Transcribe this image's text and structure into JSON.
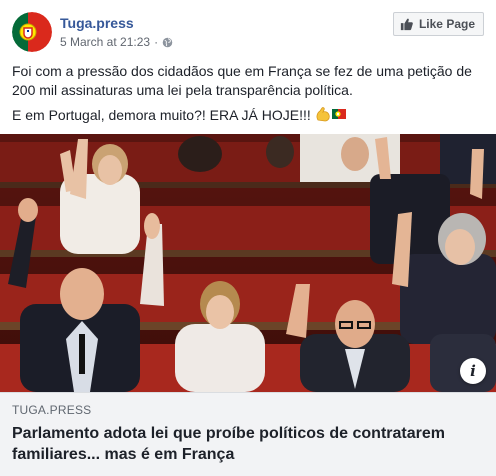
{
  "header": {
    "page_name": "Tuga.press",
    "timestamp": "5 March at 21:23",
    "separator": "·",
    "privacy_icon": "globe-icon",
    "like_page_label": "Like Page",
    "like_icon": "thumbs-up-icon"
  },
  "post": {
    "paragraph_1": "Foi com a pressão dos cidadãos que em França se fez de uma petição de 200 mil assinaturas uma lei pela transparência política.",
    "paragraph_2": "E em Portugal, demora muito?! ERA JÁ HOJE!!!",
    "emojis": [
      "flexed-biceps-emoji",
      "portugal-flag-emoji"
    ]
  },
  "photo": {
    "info_label": "i"
  },
  "link": {
    "domain": "TUGA.PRESS",
    "title": "Parlamento adota lei que proíbe políticos de contratarem familiares... mas é em França"
  },
  "colors": {
    "link_blue": "#365899",
    "text": "#1d2129",
    "meta_gray": "#616770",
    "preview_bg": "#f2f3f5",
    "seat_red": "#8b1f18"
  }
}
